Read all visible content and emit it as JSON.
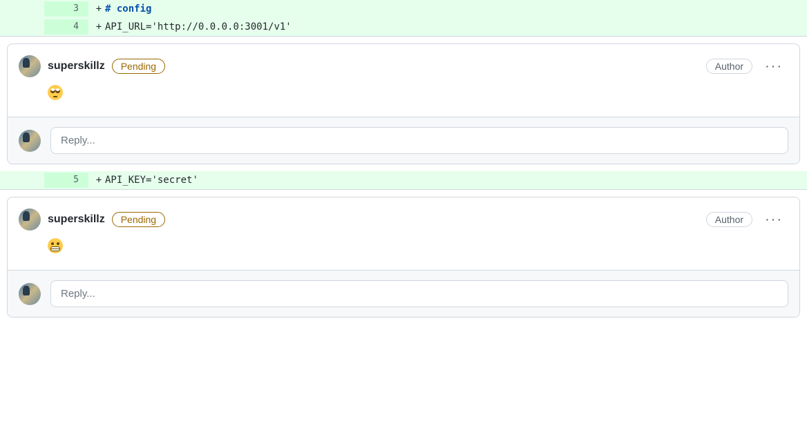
{
  "diff": {
    "lines": [
      {
        "old_num": "",
        "new_num": "3",
        "marker": "+",
        "code_html": "<span class='tok-comment'># config</span>"
      },
      {
        "old_num": "",
        "new_num": "4",
        "marker": "+",
        "code_html": "API_URL=<span class='tok-string'>'http://0.0.0.0:3001/v1'</span>"
      },
      {
        "old_num": "",
        "new_num": "5",
        "marker": "+",
        "code_html": "API_KEY=<span class='tok-string'>'secret'</span>"
      }
    ]
  },
  "comments": [
    {
      "username": "superskillz",
      "status_label": "Pending",
      "author_badge": "Author",
      "emoji": "eyeroll",
      "reply_placeholder": "Reply..."
    },
    {
      "username": "superskillz",
      "status_label": "Pending",
      "author_badge": "Author",
      "emoji": "grimace",
      "reply_placeholder": "Reply..."
    }
  ]
}
